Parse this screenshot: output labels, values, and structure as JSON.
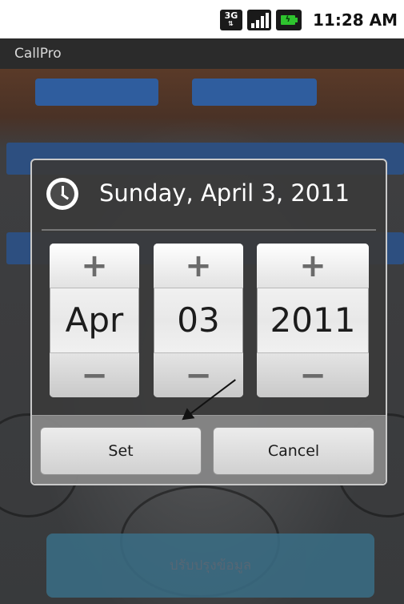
{
  "status_bar": {
    "network_type": "3G",
    "time": "11:28 AM",
    "icons": [
      "3g-icon",
      "signal-icon",
      "battery-charging-icon"
    ]
  },
  "app": {
    "title": "CallPro",
    "bottom_button_label": "ปรับปรุงข้อมูล"
  },
  "dialog": {
    "title": "Sunday, April 3, 2011",
    "icon": "clock-icon",
    "pickers": [
      {
        "name": "month",
        "value": "Apr",
        "increment": "+",
        "decrement": "−"
      },
      {
        "name": "day",
        "value": "03",
        "increment": "+",
        "decrement": "−"
      },
      {
        "name": "year",
        "value": "2011",
        "increment": "+",
        "decrement": "−"
      }
    ],
    "buttons": {
      "set": "Set",
      "cancel": "Cancel"
    }
  },
  "colors": {
    "dialog_background": "#3a3a3a",
    "app_button_blue": "#2f5d9e",
    "battery_green": "#2ec32e"
  }
}
